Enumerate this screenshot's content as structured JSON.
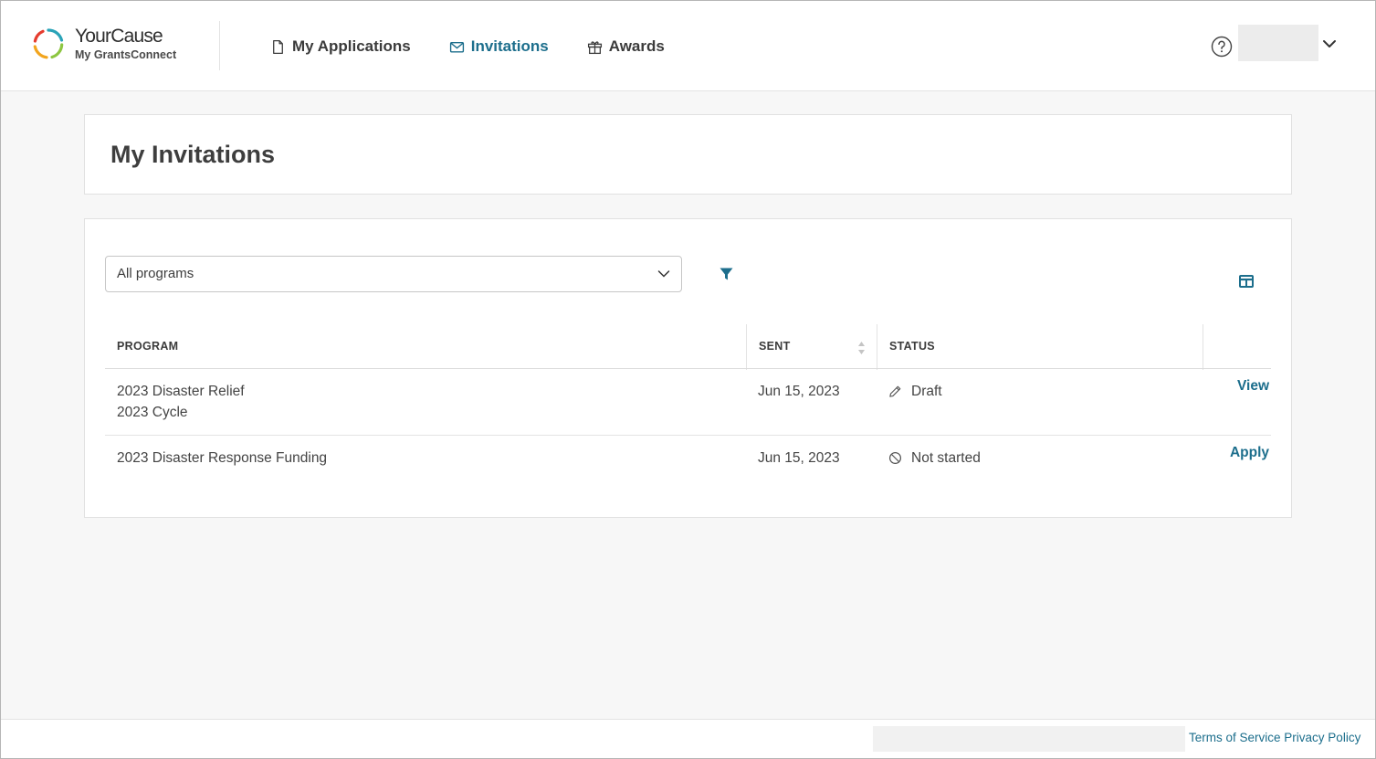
{
  "brand": {
    "name": "YourCause",
    "subtitle": "My GrantsConnect",
    "colors": [
      "#e53c2e",
      "#f2a51e",
      "#8dc641",
      "#2aa3b8"
    ]
  },
  "nav": {
    "items": [
      {
        "label": "My Applications",
        "icon": "document-icon",
        "active": false
      },
      {
        "label": "Invitations",
        "icon": "envelope-icon",
        "active": true
      },
      {
        "label": "Awards",
        "icon": "gift-icon",
        "active": false
      }
    ]
  },
  "header": {
    "help_icon": "help-circle-icon",
    "user_menu_icon": "chevron-down-icon"
  },
  "page": {
    "title": "My Invitations"
  },
  "filters": {
    "program_select_value": "All programs",
    "filter_icon": "filter-icon",
    "columns_icon": "columns-icon"
  },
  "table": {
    "columns": [
      "PROGRAM",
      "SENT",
      "STATUS"
    ],
    "rows": [
      {
        "program_line1": "2023 Disaster Relief",
        "program_line2": "2023 Cycle",
        "sent": "Jun 15, 2023",
        "status": "Draft",
        "status_icon": "pencil-icon",
        "action": "View"
      },
      {
        "program_line1": "2023 Disaster Response Funding",
        "program_line2": "",
        "sent": "Jun 15, 2023",
        "status": "Not started",
        "status_icon": "ban-icon",
        "action": "Apply"
      }
    ]
  },
  "footer": {
    "terms": "Terms of Service",
    "privacy": "Privacy Policy"
  },
  "accent_color": "#1c6e8c"
}
